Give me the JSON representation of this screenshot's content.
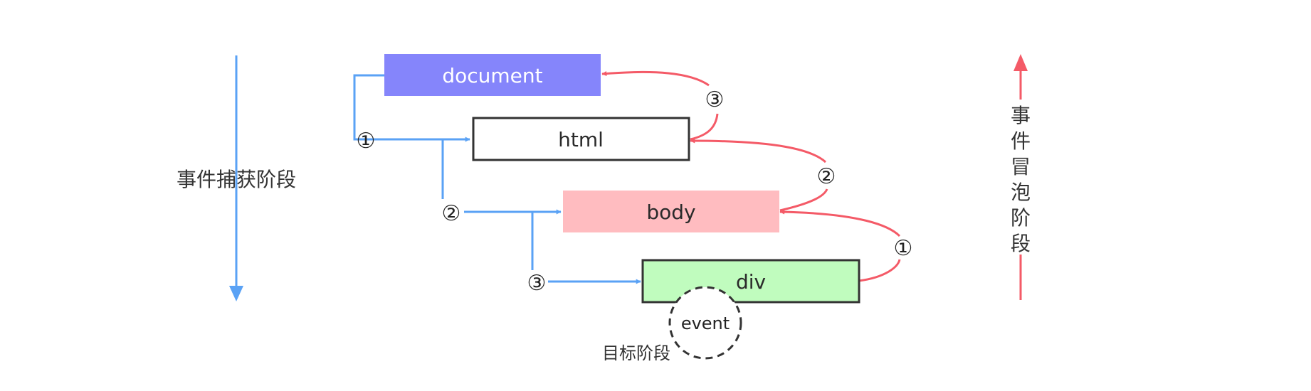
{
  "nodes": {
    "document": "document",
    "html": "html",
    "body": "body",
    "div": "div"
  },
  "event_label": "event",
  "target_phase_label": "目标阶段",
  "capture_phase_label": "事件捕获阶段",
  "bubble_phase_chars": [
    "事",
    "件",
    "冒",
    "泡",
    "阶",
    "段"
  ],
  "capture_steps": [
    "①",
    "②",
    "③"
  ],
  "bubble_steps": [
    "①",
    "②",
    "③"
  ],
  "colors": {
    "document_fill": "#8585fb",
    "html_fill": "#ffffff",
    "body_fill": "#ffbcc0",
    "div_fill": "#c0fcbe",
    "capture_arrow": "#5aa2f5",
    "bubble_arrow": "#f45a67"
  }
}
